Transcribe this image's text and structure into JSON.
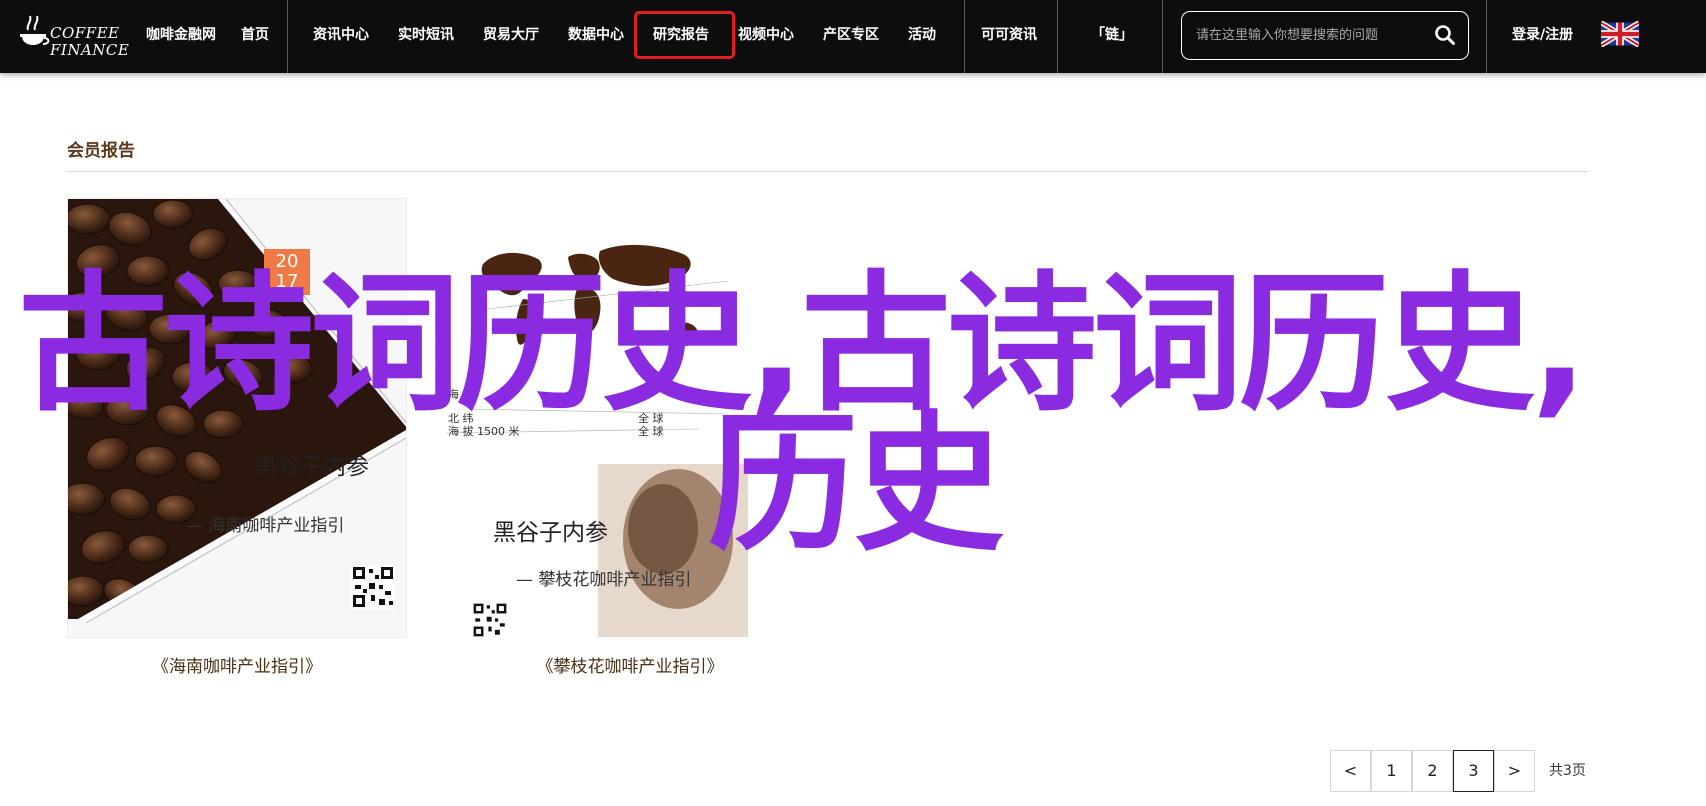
{
  "header": {
    "logo_line1": "COFFEE",
    "logo_line2": "FINANCE",
    "nav": [
      {
        "label": "咖啡金融网"
      },
      {
        "label": "首页"
      },
      {
        "label": "资讯中心"
      },
      {
        "label": "实时短讯"
      },
      {
        "label": "贸易大厅"
      },
      {
        "label": "数据中心"
      },
      {
        "label": "研究报告",
        "active": true
      },
      {
        "label": "视频中心"
      },
      {
        "label": "产区专区"
      },
      {
        "label": "活动"
      },
      {
        "label": "可可资讯"
      },
      {
        "label": "「链」"
      }
    ],
    "search_placeholder": "请在这里输入你想要搜索的问题",
    "login_label": "登录/注册",
    "active_color": "#e02020"
  },
  "section": {
    "title": "会员报告"
  },
  "cards": [
    {
      "cover_year_top": "20",
      "cover_year_bottom": "17",
      "cover_title": "黑谷子内参",
      "cover_subtitle": "— 海南咖啡产业指引",
      "caption": "《海南咖啡产业指引》"
    },
    {
      "map_labels": [
        "海 拔",
        "北 纬",
        "海 拔 1500 米",
        "全 球",
        "全 球"
      ],
      "cover_title": "黑谷子内参",
      "cover_subtitle": "— 攀枝花咖啡产业指引",
      "caption": "《攀枝花咖啡产业指引》"
    }
  ],
  "watermark": {
    "line1": "古诗词历史,古诗词历史,",
    "line2": "历史",
    "color": "#8a2be2"
  },
  "pagination": {
    "prev": "<",
    "pages": [
      "1",
      "2",
      "3"
    ],
    "current": "3",
    "next": ">",
    "total": "共3页"
  }
}
